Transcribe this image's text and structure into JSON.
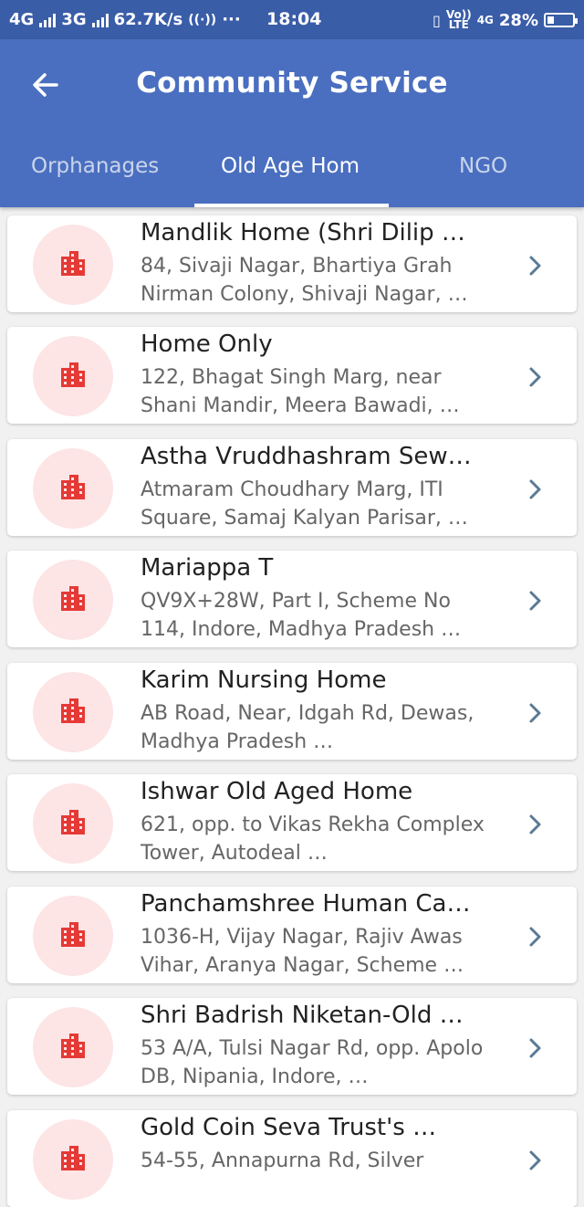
{
  "status_bar": {
    "network1": "4G",
    "network2": "3G",
    "speed": "62.7K/s",
    "dots": "···",
    "time": "18:04",
    "volte_top": "Vo))",
    "volte_bottom": "LTE",
    "lte": "4G",
    "battery": "28%",
    "battery_level": 0.28
  },
  "header": {
    "title": "Community Service"
  },
  "tabs": [
    {
      "label": "Orphanages",
      "active": false
    },
    {
      "label": "Old Age Hom",
      "active": true
    },
    {
      "label": "NGO",
      "active": false
    }
  ],
  "items": [
    {
      "name": "Mandlik Home (Shri Dilip …",
      "address": "84, Sivaji Nagar, Bhartiya Grah Nirman Colony, Shivaji Nagar, …"
    },
    {
      "name": "Home Only",
      "address": "122, Bhagat Singh Marg, near Shani Mandir, Meera Bawadi, …"
    },
    {
      "name": "Astha Vruddhashram Sew…",
      "address": "Atmaram Choudhary Marg, ITI Square, Samaj Kalyan Parisar, …"
    },
    {
      "name": "Mariappa T",
      "address": "QV9X+28W, Part I, Scheme No 114, Indore, Madhya Pradesh …"
    },
    {
      "name": "Karim Nursing Home",
      "address": "AB Road, Near, Idgah Rd, Dewas, Madhya Pradesh …"
    },
    {
      "name": "Ishwar Old Aged Home",
      "address": "621, opp. to Vikas Rekha Complex Tower, Autodeal …"
    },
    {
      "name": "Panchamshree Human Ca…",
      "address": "1036-H, Vijay Nagar, Rajiv Awas Vihar, Aranya Nagar, Scheme …"
    },
    {
      "name": "Shri Badrish Niketan-Old …",
      "address": "53 A/A, Tulsi Nagar Rd, opp. Apolo DB, Nipania, Indore, …"
    },
    {
      "name": "Gold Coin Seva Trust's …",
      "address": "54-55, Annapurna Rd, Silver"
    }
  ],
  "icons": {
    "back": "arrow-left-icon",
    "item": "building-icon",
    "chevron": "chevron-right-icon"
  },
  "colors": {
    "status_bar": "#3a5da8",
    "app_bar": "#4a6fc0",
    "icon_red": "#e53935",
    "avatar_bg": "#fde4e5",
    "chevron": "#5a7a95"
  }
}
